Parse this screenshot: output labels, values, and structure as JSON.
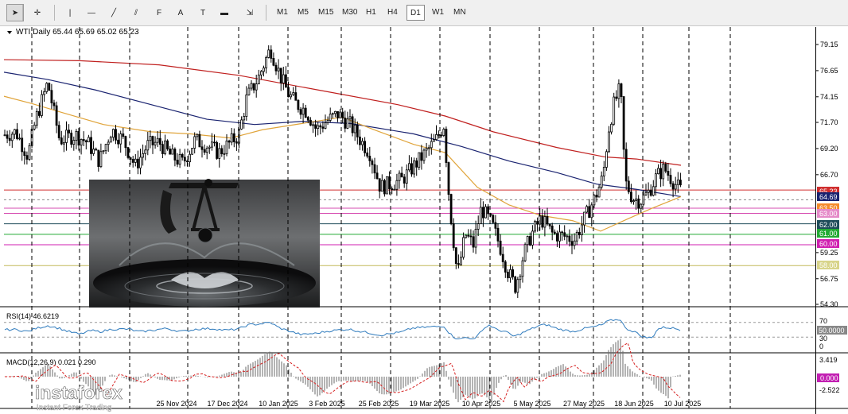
{
  "toolbar": {
    "tools": [
      {
        "name": "cursor-arrow-icon",
        "glyph": "➤"
      },
      {
        "name": "crosshair-icon",
        "glyph": "✛"
      },
      {
        "name": "vertical-line-icon",
        "glyph": "|"
      },
      {
        "name": "horizontal-line-icon",
        "glyph": "—"
      },
      {
        "name": "trend-line-icon",
        "glyph": "╱"
      },
      {
        "name": "channel-icon",
        "glyph": "⫽"
      },
      {
        "name": "fibonacci-icon",
        "glyph": "F"
      },
      {
        "name": "text-icon",
        "glyph": "A"
      },
      {
        "name": "text-label-icon",
        "glyph": "T"
      },
      {
        "name": "shapes-icon",
        "glyph": "▬"
      },
      {
        "name": "arrows-icon",
        "glyph": "⇲"
      }
    ],
    "timeframes": [
      "M1",
      "M5",
      "M15",
      "M30",
      "H1",
      "H4",
      "D1",
      "W1",
      "MN"
    ],
    "active_timeframe": "D1"
  },
  "chart": {
    "header": "WTI,Daily  65.44 65.69 65.02 65.23",
    "colors": {
      "up": "#000000",
      "ma_red": "#c0201f",
      "ma_navy": "#1a2370",
      "ma_orange": "#e0a43a",
      "rsi": "#2f7bbd",
      "macd_hist": "#6a6a6a",
      "macd_signal": "#d62020"
    },
    "price_ticks": [
      "79.15",
      "76.65",
      "74.15",
      "71.70",
      "69.20",
      "66.70",
      "59.25",
      "56.75",
      "54.30"
    ],
    "price_labels": [
      {
        "text": "65.23",
        "price": 65.23,
        "bg": "#d02e2e",
        "fg": "#ffffff",
        "line": "#d02e2e"
      },
      {
        "text": "64.69",
        "price": 64.69,
        "bg": "#1a2370",
        "fg": "#ffffff",
        "line": ""
      },
      {
        "text": "63.50",
        "price": 63.5,
        "bg": "#f58a2b",
        "fg": "#ffffff",
        "line": "#d64bb0"
      },
      {
        "text": "63.00",
        "price": 63.0,
        "bg": "#e58ac8",
        "fg": "#ffffff",
        "line": "#d64bb0"
      },
      {
        "text": "62.00",
        "price": 62.0,
        "bg": "#1f4c5a",
        "fg": "#ffffff",
        "line": "#1f4c5a"
      },
      {
        "text": "61.00",
        "price": 61.0,
        "bg": "#22aa33",
        "fg": "#ffffff",
        "line": "#22aa33"
      },
      {
        "text": "60.00",
        "price": 60.0,
        "bg": "#d01fb0",
        "fg": "#ffffff",
        "line": "#d01fb0"
      },
      {
        "text": "58.00",
        "price": 58.0,
        "bg": "#d8d48a",
        "fg": "#ffffff",
        "line": "#c2b85a"
      }
    ],
    "rsi_label": "RSI(14) 46.6219",
    "rsi_ticks": [
      "70",
      "30",
      "0"
    ],
    "rsi_marker": "50.0000",
    "macd_label": "MACD(12,26,9) 0.021 0.290",
    "macd_ticks": [
      "3.419",
      "-2.522"
    ],
    "macd_marker": "0.000",
    "dates": [
      "25 Nov 2024",
      "17 Dec 2024",
      "10 Jan 2025",
      "3 Feb 2025",
      "25 Feb 2025",
      "19 Mar 2025",
      "10 Apr 2025",
      "5 May 2025",
      "27 May 2025",
      "18 Jun 2025",
      "10 Jul 2025"
    ]
  },
  "brand": {
    "name": "instaforex",
    "tagline": "Instant Forex Trading"
  }
}
